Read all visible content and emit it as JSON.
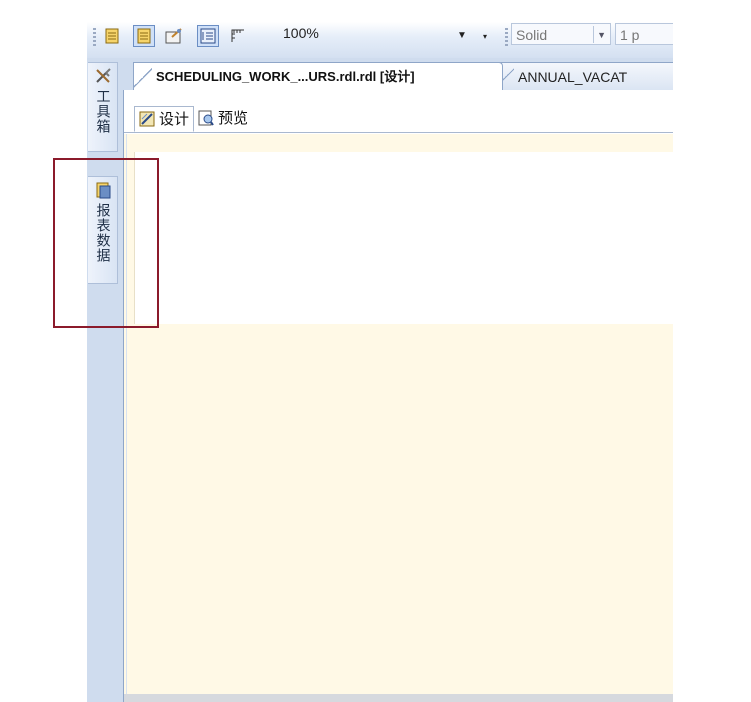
{
  "toolbar": {
    "zoom": "100%",
    "border_style": "Solid",
    "border_width": "1 p"
  },
  "side_strip": {
    "toolbox_label": "工具箱",
    "report_data_label": "报表数据"
  },
  "document_tabs": [
    {
      "label": "SCHEDULING_WORK_...URS.rdl.rdl [设计]",
      "active": true
    },
    {
      "label": "ANNUAL_VACAT",
      "active": false
    }
  ],
  "view_tabs": {
    "design": "设计",
    "preview": "预览"
  },
  "colors": {
    "highlight": "#8b1a2b",
    "canvas_bg": "#fff9e6",
    "chrome": "#cfdcee"
  }
}
